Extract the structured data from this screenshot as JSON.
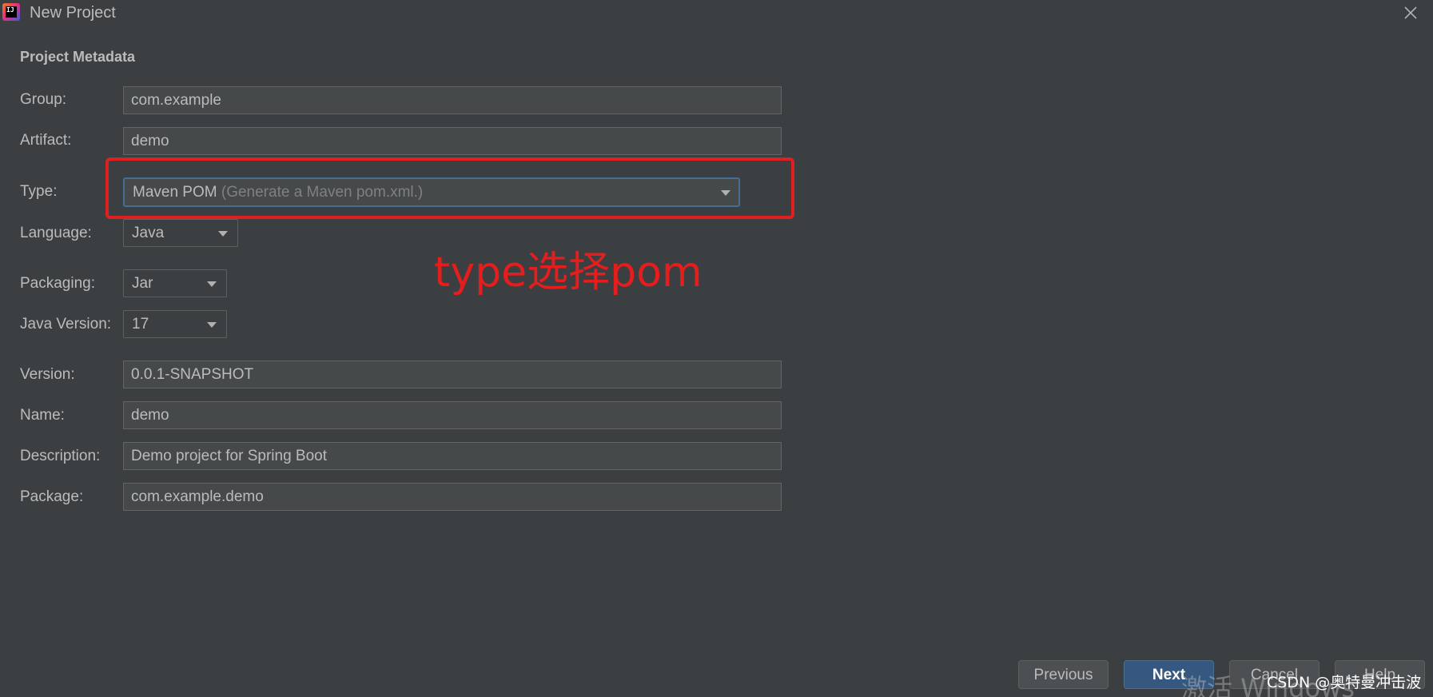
{
  "window": {
    "title": "New Project",
    "icon_text": "IJ"
  },
  "section": {
    "title": "Project Metadata"
  },
  "fields": {
    "group": {
      "label": "Group:",
      "value": "com.example"
    },
    "artifact": {
      "label": "Artifact:",
      "value": "demo"
    },
    "type": {
      "label": "Type:",
      "value": "Maven POM",
      "hint": "(Generate a Maven pom.xml.)"
    },
    "language": {
      "label": "Language:",
      "value": "Java"
    },
    "packaging": {
      "label": "Packaging:",
      "value": "Jar"
    },
    "java_version": {
      "label": "Java Version:",
      "value": "17"
    },
    "version": {
      "label": "Version:",
      "value": "0.0.1-SNAPSHOT"
    },
    "name": {
      "label": "Name:",
      "value": "demo"
    },
    "description": {
      "label": "Description:",
      "value": "Demo project for Spring Boot"
    },
    "package": {
      "label": "Package:",
      "value": "com.example.demo"
    }
  },
  "annotation": {
    "text": "type选择pom",
    "color": "#e61d1d"
  },
  "buttons": {
    "previous": "Previous",
    "next": "Next",
    "cancel": "Cancel",
    "help": "Help"
  },
  "overlay": {
    "windows_watermark": "激活 Windows",
    "csdn_watermark": "CSDN @奥特曼冲击波"
  },
  "colors": {
    "background": "#3c3f41",
    "field_bg": "#45494a",
    "focus_border": "#466d94",
    "primary_button": "#365880",
    "highlight": "#e02020"
  }
}
